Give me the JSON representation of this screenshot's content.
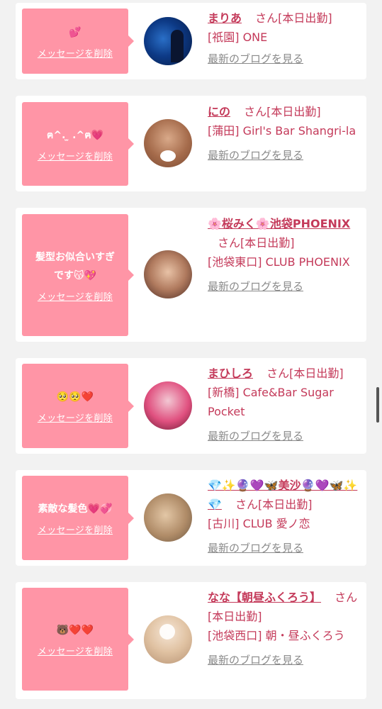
{
  "colors": {
    "accent": "#ff95a6",
    "name": "#c43a5a",
    "muted": "#8a8a8a",
    "background": "#f2f2f2"
  },
  "delete_label": "メッセージを削除",
  "blog_label": "最新のブログを見る",
  "cards": [
    {
      "message": "💕",
      "name": "まりあ",
      "san": "さん[本日出勤]",
      "shop": "[祇園] ONE"
    },
    {
      "message": "ฅ^. ̫ .^ฅ💗",
      "name": "にの",
      "san": "さん[本日出勤]",
      "shop": "[蒲田] Girl's Bar Shangri-la"
    },
    {
      "message": "髪型お似合いすぎです😽💖",
      "name": "🌸桜みく🌸池袋PHOENIX",
      "san": "さん[本日出勤]",
      "shop": "[池袋東口] CLUB PHOENIX"
    },
    {
      "message": "🥺🥺❤️",
      "name": "まひしろ",
      "san": "さん[本日出勤]",
      "shop": "[新橋] Cafe&Bar Sugar Pocket"
    },
    {
      "message": "素敵な髪色💗💞",
      "name": "💎✨🔮💜🦋美沙🔮💜🦋✨💎",
      "san": "さん[本日出勤]",
      "shop": "[古川] CLUB 愛ノ恋"
    },
    {
      "message": "🐻❤️❤️",
      "name": "なな【朝昼ふくろう】",
      "san": "さん[本日出勤]",
      "shop": "[池袋西口] 朝・昼ふくろう"
    }
  ]
}
